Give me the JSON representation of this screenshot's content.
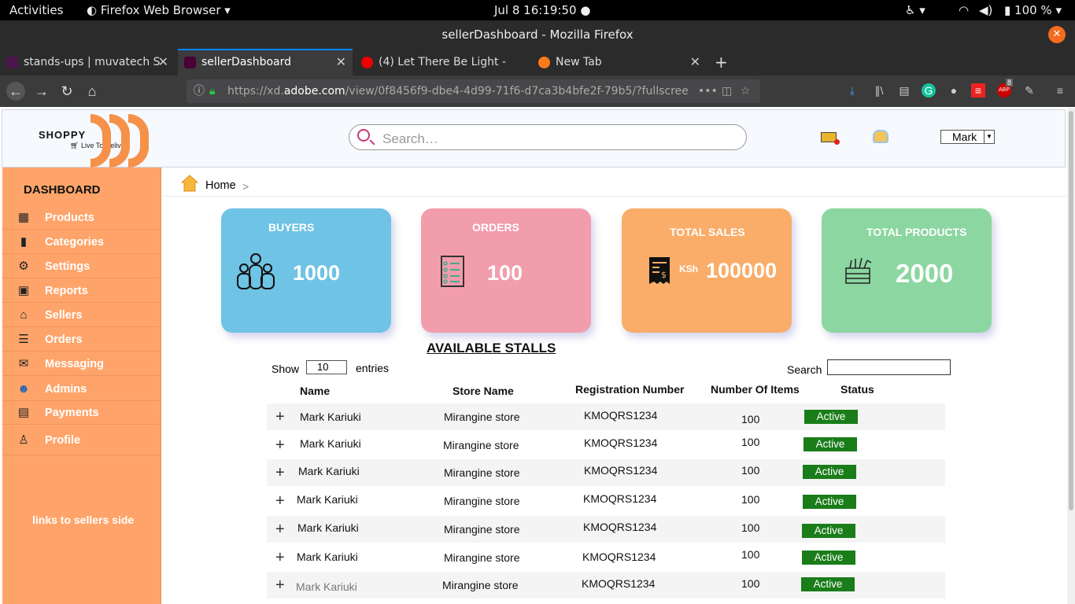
{
  "system": {
    "activities": "Activities",
    "app": "Firefox Web Browser",
    "clock": "Jul 8  16:19:50",
    "battery": "100 %"
  },
  "browser": {
    "window_title": "sellerDashboard - Mozilla Firefox",
    "tabs": [
      {
        "label": "stands-ups | muvatech S"
      },
      {
        "label": "sellerDashboard"
      },
      {
        "label": "(4) Let There Be Light -"
      },
      {
        "label": "New Tab"
      }
    ],
    "url_prefix": "https://xd.",
    "url_domain": "adobe.com",
    "url_rest": "/view/0f8456f9-dbe4-4d99-71f6-d7ca3b4bfe2f-79b5/?fullscree",
    "abp_count": "8"
  },
  "header": {
    "logo_name": "SHOPPY",
    "logo_tagline": "Live To Deliver",
    "search_placeholder": "Search…",
    "user": "Mark"
  },
  "sidebar": {
    "title": "DASHBOARD",
    "items": [
      {
        "label": "Products",
        "icon": "products-icon"
      },
      {
        "label": "Categories",
        "icon": "categories-icon"
      },
      {
        "label": "Settings",
        "icon": "gear-icon"
      },
      {
        "label": "Reports",
        "icon": "reports-icon"
      },
      {
        "label": "Sellers",
        "icon": "store-icon"
      },
      {
        "label": "Orders",
        "icon": "orders-icon"
      },
      {
        "label": "Messaging",
        "icon": "mail-icon"
      },
      {
        "label": "Admins",
        "icon": "admins-icon"
      },
      {
        "label": "Payments",
        "icon": "payments-icon"
      },
      {
        "label": "Profile",
        "icon": "user-icon"
      }
    ],
    "note": "links to sellers side"
  },
  "breadcrumb": {
    "home": "Home",
    "sep": ">"
  },
  "cards": [
    {
      "title": "BUYERS",
      "value": "1000",
      "color": "#6fc3e4"
    },
    {
      "title": "ORDERS",
      "value": "100",
      "color": "#f29dac"
    },
    {
      "title": "TOTAL SALES",
      "currency": "KSh",
      "value": "100000",
      "color": "#f9ad69"
    },
    {
      "title": "TOTAL PRODUCTS",
      "value": "2000",
      "color": "#8bd6a1"
    }
  ],
  "table": {
    "title": "AVAILABLE STALLS",
    "show_label": "Show",
    "show_value": "10",
    "entries_label": "entries",
    "search_label": "Search",
    "columns": [
      "Name",
      "Store Name",
      "Registration Number",
      "Number Of Items",
      "Status"
    ],
    "rows": [
      [
        "Mark Kariuki",
        "Mirangine store",
        "KMOQRS1234",
        "100",
        "Active"
      ],
      [
        "Mark Kariuki",
        "Mirangine store",
        "KMOQRS1234",
        "100",
        "Active"
      ],
      [
        "Mark Kariuki",
        "Mirangine store",
        "KMOQRS1234",
        "100",
        "Active"
      ],
      [
        "Mark Kariuki",
        "Mirangine store",
        "KMOQRS1234",
        "100",
        "Active"
      ],
      [
        "Mark Kariuki",
        "Mirangine store",
        "KMOQRS1234",
        "100",
        "Active"
      ],
      [
        "Mark Kariuki",
        "Mirangine store",
        "KMOQRS1234",
        "100",
        "Active"
      ],
      [
        "Mark Kariuki",
        "Mirangine store",
        "KMOQRS1234",
        "100",
        "Active"
      ]
    ]
  }
}
